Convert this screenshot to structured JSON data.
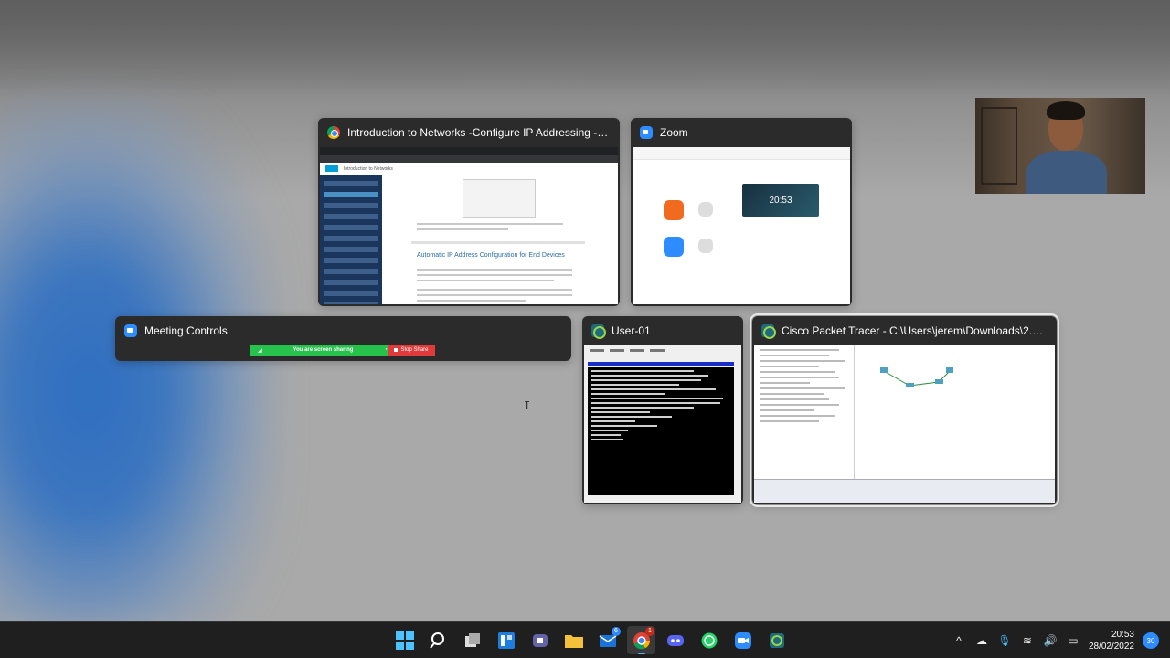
{
  "windows": {
    "chrome": {
      "title": "Introduction to Networks -Configure IP Addressing - Goo...",
      "page_header": "Introduction to Networks",
      "page_heading": "Automatic IP Address Configuration for End Devices"
    },
    "zoom": {
      "title": "Zoom",
      "clock": "20:53"
    },
    "meeting_controls": {
      "title": "Meeting Controls",
      "sharing_text": "You are screen sharing",
      "stop_share_label": "Stop Share"
    },
    "user01": {
      "title": "User-01"
    },
    "packet_tracer": {
      "title": "Cisco Packet Tracer - C:\\Users\\jerem\\Downloads\\2.9.1-pac..."
    }
  },
  "taskbar": {
    "apps": [
      {
        "name": "windows-start",
        "icon": "windows-icon"
      },
      {
        "name": "search",
        "icon": "search-icon"
      },
      {
        "name": "task-view",
        "icon": "task-view-icon"
      },
      {
        "name": "widgets",
        "icon": "widgets-icon"
      },
      {
        "name": "teams",
        "icon": "teams-icon"
      },
      {
        "name": "file-explorer",
        "icon": "folder-icon"
      },
      {
        "name": "mail",
        "icon": "mail-icon",
        "badge": "6"
      },
      {
        "name": "chrome",
        "icon": "chrome-icon",
        "badge": "1"
      },
      {
        "name": "discord",
        "icon": "discord-icon"
      },
      {
        "name": "whatsapp",
        "icon": "whatsapp-icon"
      },
      {
        "name": "zoom",
        "icon": "zoom-icon"
      },
      {
        "name": "packet-tracer",
        "icon": "packet-tracer-icon"
      }
    ],
    "time": "20:53",
    "date": "28/02/2022",
    "notification_count": "30"
  },
  "colors": {
    "taskbar_bg": "#1f1f1f",
    "share_green": "#27c24c",
    "stop_red": "#e03a3a",
    "zoom_blue": "#2d8cff"
  }
}
